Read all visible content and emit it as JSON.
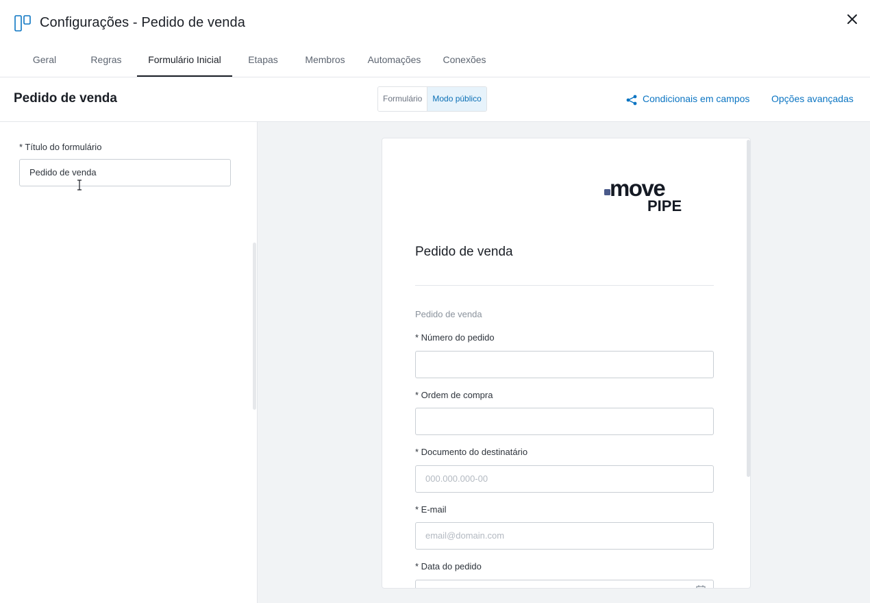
{
  "header": {
    "title": "Configurações - Pedido de venda"
  },
  "tabs": [
    {
      "label": "Geral"
    },
    {
      "label": "Regras"
    },
    {
      "label": "Formulário Inicial"
    },
    {
      "label": "Etapas"
    },
    {
      "label": "Membros"
    },
    {
      "label": "Automações"
    },
    {
      "label": "Conexões"
    }
  ],
  "active_tab": "Formulário Inicial",
  "subheader": {
    "form_name": "Pedido de venda",
    "toggle": {
      "formulario": "Formulário",
      "modo_publico": "Modo público",
      "selected": "Modo público"
    },
    "conditionals_link": "Condicionais em campos",
    "advanced_link": "Opções avançadas"
  },
  "left_panel": {
    "title_label": "* Título do formulário",
    "title_value": "Pedido de venda"
  },
  "preview": {
    "logo": {
      "line1": ".move",
      "line2": "PIPE"
    },
    "card_title": "Pedido de venda",
    "section_label": "Pedido de venda",
    "fields": [
      {
        "label": "* Número do pedido",
        "placeholder": ""
      },
      {
        "label": "* Ordem de compra",
        "placeholder": ""
      },
      {
        "label": "* Documento do destinatário",
        "placeholder": "000.000.000-00"
      },
      {
        "label": "* E-mail",
        "placeholder": "email@domain.com"
      },
      {
        "label": "* Data do pedido",
        "placeholder": ""
      }
    ]
  },
  "colors": {
    "accent": "#0a74c2",
    "segment_active_bg": "#e7f3fb",
    "preview_bg": "#f1f3f5"
  },
  "icons": [
    "board-icon",
    "close-icon",
    "share-nodes-icon",
    "text-cursor-icon",
    "calendar-icon"
  ]
}
